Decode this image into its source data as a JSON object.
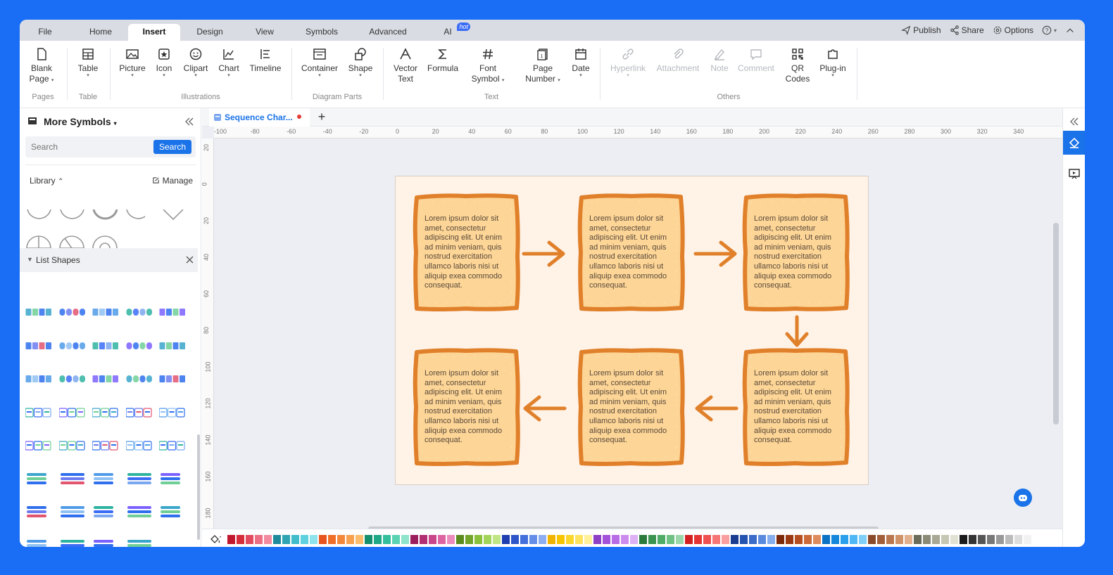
{
  "menu": {
    "items": [
      "File",
      "Home",
      "Insert",
      "Design",
      "View",
      "Symbols",
      "Advanced",
      "AI"
    ],
    "active": "Insert",
    "hot_badge": "hot"
  },
  "top_right": {
    "publish": "Publish",
    "share": "Share",
    "options": "Options"
  },
  "ribbon": {
    "blank_page": [
      "Blank",
      "Page"
    ],
    "table": "Table",
    "picture": "Picture",
    "icon": "Icon",
    "clipart": "Clipart",
    "chart": "Chart",
    "timeline": "Timeline",
    "container": "Container",
    "shape": "Shape",
    "vector_text": [
      "Vector",
      "Text"
    ],
    "formula": "Formula",
    "font_symbol": [
      "Font",
      "Symbol"
    ],
    "page_number": [
      "Page",
      "Number"
    ],
    "date": "Date",
    "hyperlink": "Hyperlink",
    "attachment": "Attachment",
    "note": "Note",
    "comment": "Comment",
    "qr_codes": [
      "QR",
      "Codes"
    ],
    "plugin": "Plug-in",
    "groups": {
      "pages": "Pages",
      "table": "Table",
      "illustrations": "Illustrations",
      "diagram_parts": "Diagram Parts",
      "text": "Text",
      "others": "Others"
    }
  },
  "left_panel": {
    "title": "More Symbols",
    "search_placeholder": "Search",
    "search_button": "Search",
    "library": "Library",
    "manage": "Manage",
    "list_shapes": "List Shapes"
  },
  "document": {
    "tab_title": "Sequence Char...",
    "ruler_h": [
      "-100",
      "-80",
      "-60",
      "-40",
      "-20",
      "0",
      "20",
      "40",
      "60",
      "80",
      "100",
      "120",
      "140",
      "160",
      "180",
      "200",
      "220",
      "240",
      "260",
      "280",
      "300",
      "320",
      "340"
    ],
    "ruler_v": [
      "20",
      "0",
      "20",
      "40",
      "60",
      "80",
      "100",
      "120",
      "140",
      "160",
      "180"
    ],
    "card_text": "Lorem ipsum dolor sit amet, consectetur adipiscing elit. Ut enim ad minim veniam, quis nostrud exercitation ullamco laboris nisi ut aliquip exea commodo consequat."
  },
  "colors": {
    "accent": "#1a73e8",
    "card_fill": "#fdd596",
    "card_border": "#e0802a",
    "page_bg": "#fff2e7",
    "swatches": [
      "#c0182c",
      "#d62d3a",
      "#e24b5f",
      "#ec6f83",
      "#f28aa0",
      "#1f8a9b",
      "#2fa5b3",
      "#40bccb",
      "#5fd1de",
      "#8ee3ec",
      "#e8541e",
      "#f06e27",
      "#f4883a",
      "#f8a24f",
      "#fbbd6c",
      "#148f6e",
      "#1ea886",
      "#34bf9c",
      "#5ad3b3",
      "#8fe4cc",
      "#9b1f5f",
      "#b22f74",
      "#c9468b",
      "#dd64a3",
      "#ec8bbd",
      "#5b8a1e",
      "#72a52a",
      "#8ac03a",
      "#a3d45a",
      "#c0e585",
      "#1f3fb0",
      "#2d56c8",
      "#4470dc",
      "#658ee8",
      "#8eaef1",
      "#f0b400",
      "#f7c600",
      "#fbd62b",
      "#fde35e",
      "#fff09a",
      "#8d3fc5",
      "#a352d9",
      "#b86ce6",
      "#cc8cee",
      "#deb0f4",
      "#2a7a3b",
      "#3a9450",
      "#4eac66",
      "#70c184",
      "#9cd7a9",
      "#d22020",
      "#e43434",
      "#ef5050",
      "#f67676",
      "#fa9f9f",
      "#1b3d91",
      "#2553b0",
      "#3a6cc8",
      "#5a8ade",
      "#86aeec",
      "#7a2a0a",
      "#993a14",
      "#b54f22",
      "#cc6a3a",
      "#de8c5e",
      "#0b72c4",
      "#1588dc",
      "#2aa0ec",
      "#4fb8f4",
      "#80cff8",
      "#8a4a2a",
      "#a25e3a",
      "#ba764e",
      "#d09268",
      "#e2b08c",
      "#6b6b5a",
      "#8a8a76",
      "#a8a894",
      "#c6c6b4",
      "#e2e2d4",
      "#1a1a1a",
      "#333333",
      "#555555",
      "#777777",
      "#999999",
      "#bbbbbb",
      "#dddddd",
      "#f2f2f2"
    ]
  }
}
